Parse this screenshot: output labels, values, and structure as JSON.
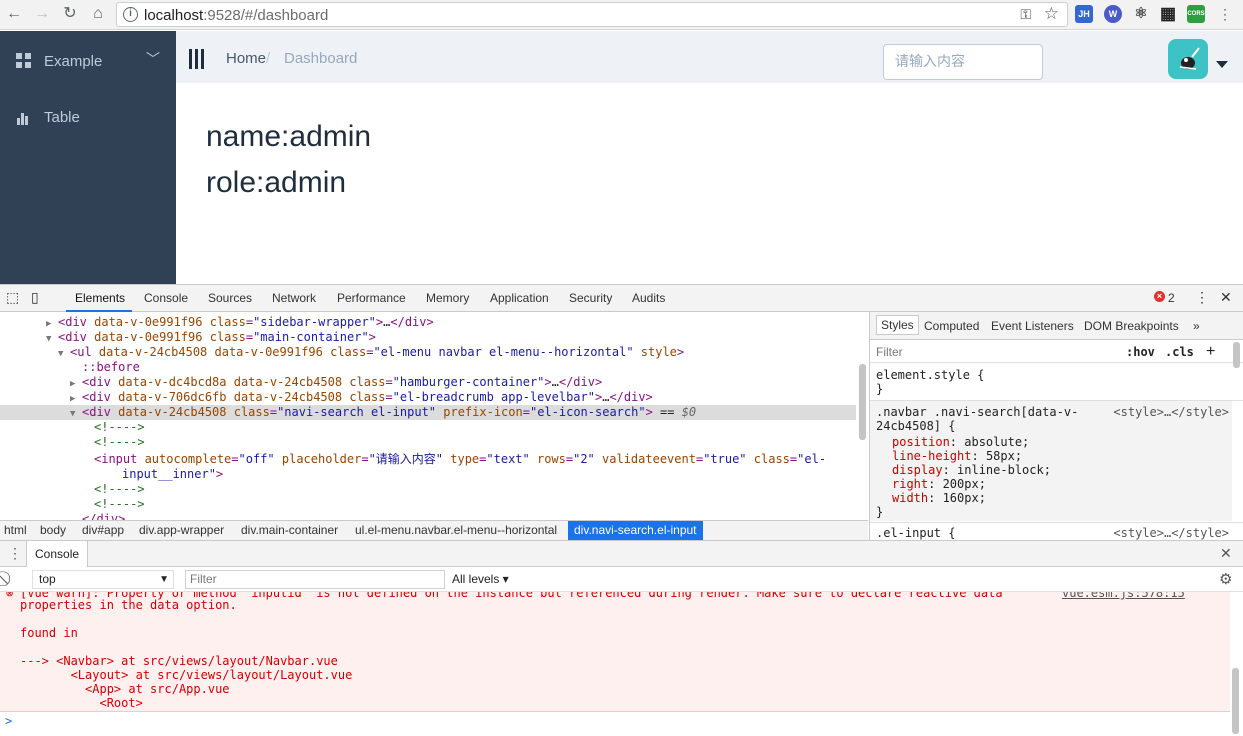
{
  "browser": {
    "url_host": "localhost",
    "url_path": ":9528/#/dashboard",
    "extensions": [
      {
        "name": "jh-extension-icon",
        "text": "JH",
        "color": "#3367d6"
      },
      {
        "name": "wa-extension-icon",
        "text": "Wa",
        "color": "#4a5ac9"
      },
      {
        "name": "react-devtools-icon",
        "text": "⚛",
        "color": "#ffffff"
      },
      {
        "name": "qr-code-icon",
        "text": "▦",
        "color": "#ffffff"
      },
      {
        "name": "cors-extension-icon",
        "text": "CORS",
        "color": "#2e9e3e"
      }
    ]
  },
  "sidebar": {
    "items": [
      {
        "label": "Example"
      },
      {
        "label": "Table"
      }
    ]
  },
  "navbar": {
    "breadcrumb_home": "Home",
    "breadcrumb_separator": "/",
    "breadcrumb_current": "Dashboard",
    "search_placeholder": "请输入内容"
  },
  "main": {
    "name_line": "name:admin",
    "role_line": "role:admin"
  },
  "devtools": {
    "tabs": [
      "Elements",
      "Console",
      "Sources",
      "Network",
      "Performance",
      "Memory",
      "Application",
      "Security",
      "Audits"
    ],
    "error_count": "2",
    "breadcrumbs": [
      "html",
      "body",
      "div#app",
      "div.app-wrapper",
      "div.main-container",
      "ul.el-menu.navbar.el-menu--horizontal",
      "div.navi-search.el-input"
    ],
    "styles_tabs": [
      "Styles",
      "Computed",
      "Event Listeners",
      "DOM Breakpoints",
      "»"
    ],
    "styles_filter": "Filter",
    "styles_hov": ":hov",
    "styles_cls": ".cls",
    "styles_plus": "+",
    "style_rules": {
      "element_style": "element.style {",
      "rule_close": "}",
      "selector_line1": ".navbar .navi-search[data-v-",
      "selector_line2": "24cb4508] {",
      "source": "<style>…</style>",
      "props": [
        {
          "name": "position",
          "value": "absolute;"
        },
        {
          "name": "line-height",
          "value": "58px;"
        },
        {
          "name": "display",
          "value": "inline-block;"
        },
        {
          "name": "right",
          "value": "200px;"
        },
        {
          "name": "width",
          "value": "160px;"
        }
      ],
      "next_selector": ".el-input {"
    },
    "console": {
      "tab_label": "Console",
      "context": "top",
      "filter_placeholder": "Filter",
      "levels": "All levels ▾",
      "lines": [
        "[Vue warn]: Property or method \"inputid\" is not defined on the instance but referenced during render. Make sure to declare reactive data",
        "properties in the data option.",
        "",
        "found in",
        "",
        "---> <Navbar> at src/views/layout/Navbar.vue",
        "       <Layout> at src/views/layout/Layout.vue",
        "         <App> at src/App.vue",
        "           <Root>"
      ],
      "source_link": "vue.esm.js:578:15",
      "prompt": ">"
    }
  }
}
